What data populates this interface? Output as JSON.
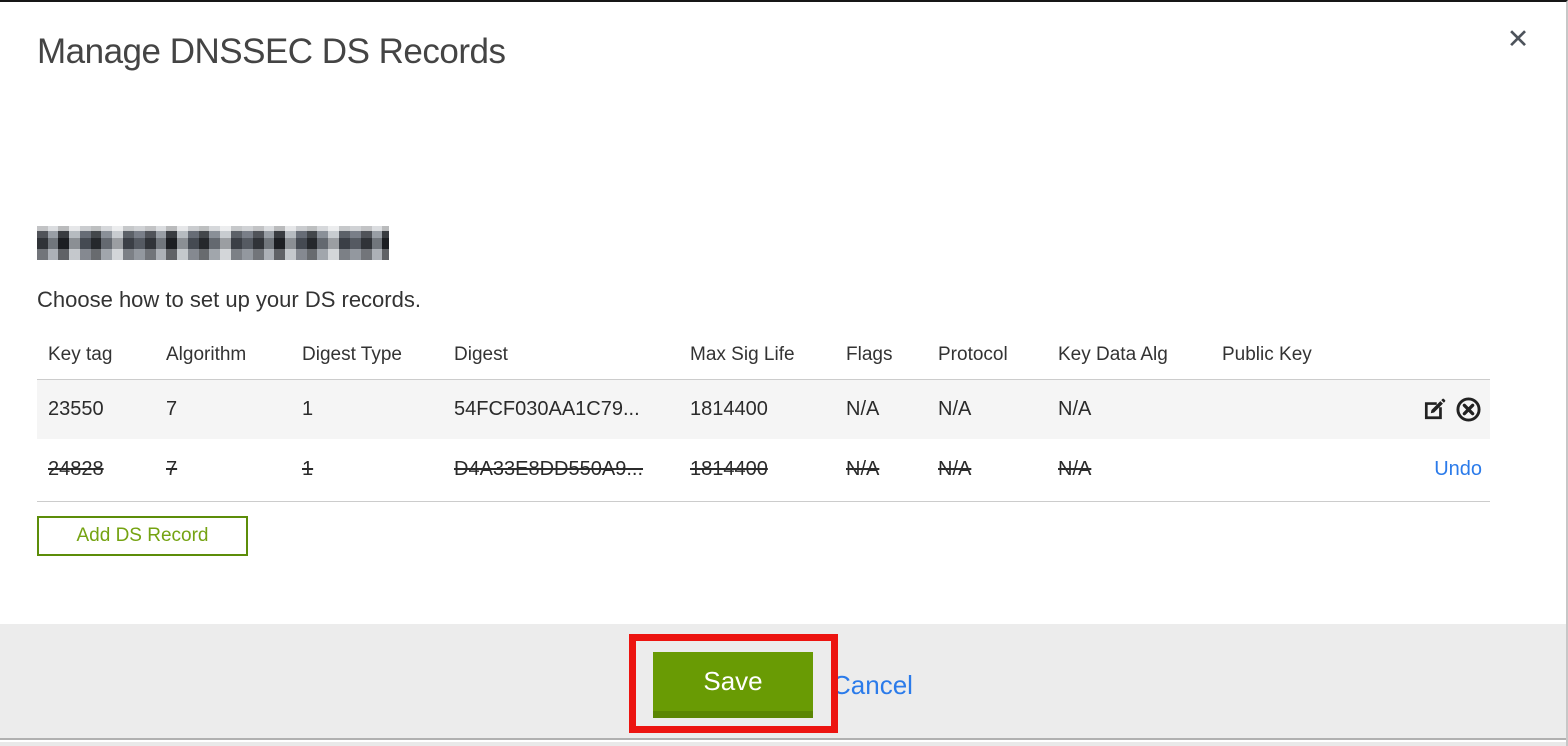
{
  "modal": {
    "title": "Manage DNSSEC DS Records",
    "close_glyph": "✕",
    "instruction": "Choose how to set up your DS records.",
    "domain_redacted": true
  },
  "table": {
    "headers": [
      "Key tag",
      "Algorithm",
      "Digest Type",
      "Digest",
      "Max Sig Life",
      "Flags",
      "Protocol",
      "Key Data Alg",
      "Public Key"
    ],
    "rows": [
      {
        "key_tag": "23550",
        "algorithm": "7",
        "digest_type": "1",
        "digest": "54FCF030AA1C79...",
        "max_sig_life": "1814400",
        "flags": "N/A",
        "protocol": "N/A",
        "key_data_alg": "N/A",
        "public_key": "",
        "state": "normal",
        "actions": [
          "edit",
          "delete"
        ]
      },
      {
        "key_tag": "24828",
        "algorithm": "7",
        "digest_type": "1",
        "digest": "D4A33E8DD550A9...",
        "max_sig_life": "1814400",
        "flags": "N/A",
        "protocol": "N/A",
        "key_data_alg": "N/A",
        "public_key": "",
        "state": "deleted",
        "action_label": "Undo"
      }
    ]
  },
  "buttons": {
    "add_ds_record": "Add DS Record",
    "save": "Save",
    "cancel": "Cancel"
  },
  "annotation": {
    "type": "highlight-box",
    "target": "save-button"
  },
  "colors": {
    "accent_green": "#699b04",
    "green_dark": "#5a8603",
    "green_border": "#5c8d09",
    "green_text": "#75a312",
    "link_blue": "#2b7bea",
    "annotation_red": "#ec1410",
    "footer_bg": "#ececec",
    "row_alt_bg": "#f5f5f5",
    "border_gray": "#cccccc"
  }
}
